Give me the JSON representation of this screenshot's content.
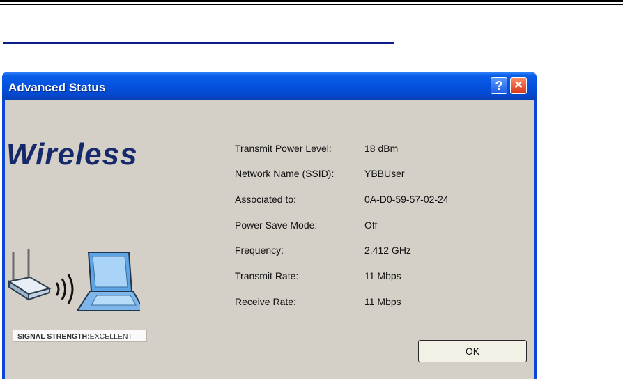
{
  "window": {
    "title": "Advanced Status",
    "help_glyph": "?",
    "close_glyph": "✕"
  },
  "brand": {
    "logo_text": "Wireless"
  },
  "signal": {
    "label": "SIGNAL STRENGTH:",
    "value": "EXCELLENT"
  },
  "status_rows": [
    {
      "label": "Transmit Power Level:",
      "value": "18 dBm"
    },
    {
      "label": "Network Name (SSID):",
      "value": "YBBUser"
    },
    {
      "label": "Associated  to:",
      "value": "0A-D0-59-57-02-24"
    },
    {
      "label": "Power Save Mode:",
      "value": "Off"
    },
    {
      "label": "Frequency:",
      "value": "2.412 GHz"
    },
    {
      "label": "Transmit Rate:",
      "value": "11 Mbps"
    },
    {
      "label": "Receive Rate:",
      "value": "11 Mbps"
    }
  ],
  "actions": {
    "ok_label": "OK"
  },
  "icons": {
    "illustration": "router-to-laptop-icon"
  },
  "colors": {
    "titlebar": "#0553e0",
    "client_bg": "#d4d0c8",
    "brand_text": "#15296b",
    "close_button": "#d8341a"
  }
}
